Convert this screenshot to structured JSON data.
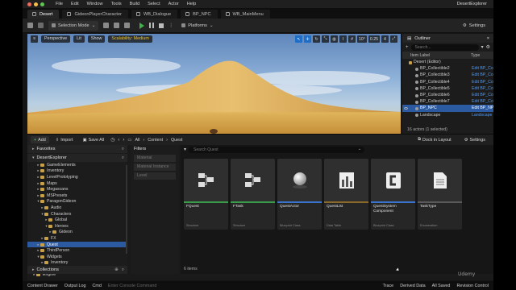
{
  "menubar": {
    "menus": [
      "File",
      "Edit",
      "Window",
      "Tools",
      "Build",
      "Select",
      "Actor",
      "Help"
    ],
    "app_title": "DesertExplorer",
    "traffic_colors": [
      "#ec6a5e",
      "#f4bf4f",
      "#61c554"
    ]
  },
  "tabs": [
    {
      "label": "Desert",
      "active": true
    },
    {
      "label": "GideonPlayerCharacter",
      "active": false
    },
    {
      "label": "WB_Dialogue",
      "active": false
    },
    {
      "label": "BP_NPC",
      "active": false
    },
    {
      "label": "WB_MainMenu",
      "active": false
    }
  ],
  "toolbar": {
    "selection_mode": "Selection Mode",
    "platforms": "Platforms",
    "settings": "Settings"
  },
  "viewport": {
    "perspective": "Perspective",
    "lit": "Lit",
    "show": "Show",
    "scalability": "Scalability: Medium",
    "snap_angle": "10°",
    "snap_scale": "0.25",
    "camera_speed": "4"
  },
  "outliner": {
    "title": "Outliner",
    "search_placeholder": "Search...",
    "col_label": "Item Label",
    "col_type": "Type",
    "rows": [
      {
        "name": "Desert (Editor)",
        "type": "",
        "kind": "root",
        "selected": false
      },
      {
        "name": "BP_Collectible2",
        "type": "Edit BP_Colle",
        "kind": "actor",
        "selected": false
      },
      {
        "name": "BP_Collectible3",
        "type": "Edit BP_Colle",
        "kind": "actor",
        "selected": false
      },
      {
        "name": "BP_Collectible4",
        "type": "Edit BP_Colle",
        "kind": "actor",
        "selected": false
      },
      {
        "name": "BP_Collectible5",
        "type": "Edit BP_Colle",
        "kind": "actor",
        "selected": false
      },
      {
        "name": "BP_Collectible6",
        "type": "Edit BP_Colle",
        "kind": "actor",
        "selected": false
      },
      {
        "name": "BP_Collectible7",
        "type": "Edit BP_Colle",
        "kind": "actor",
        "selected": false
      },
      {
        "name": "BP_NPC",
        "type": "Edit BP_NPC",
        "kind": "actor",
        "selected": true
      },
      {
        "name": "Landscape",
        "type": "Landscape",
        "kind": "actor",
        "selected": false
      }
    ],
    "footer": "16 actors (1 selected)"
  },
  "content_browser": {
    "add_label": "Add",
    "import_label": "Import",
    "save_all_label": "Save All",
    "breadcrumb": [
      "All",
      "Content",
      "Quest"
    ],
    "dock_label": "Dock in Layout",
    "settings_label": "Settings",
    "favorites_label": "Favorites",
    "project_label": "DesertExplorer",
    "collections_label": "Collections",
    "filters_title": "Filters",
    "filter_items": [
      "Material",
      "Material Instance",
      "Level"
    ],
    "search_placeholder": "Search Quest",
    "items_count": "6 items",
    "tree": [
      {
        "label": "GameElements",
        "depth": 1,
        "expanded": false,
        "selected": false
      },
      {
        "label": "Inventory",
        "depth": 1,
        "expanded": false,
        "selected": false
      },
      {
        "label": "LevelPrototyping",
        "depth": 1,
        "expanded": false,
        "selected": false
      },
      {
        "label": "Maps",
        "depth": 1,
        "expanded": false,
        "selected": false
      },
      {
        "label": "Megascans",
        "depth": 1,
        "expanded": false,
        "selected": false
      },
      {
        "label": "MSPresets",
        "depth": 1,
        "expanded": false,
        "selected": false
      },
      {
        "label": "ParagonGideon",
        "depth": 1,
        "expanded": true,
        "selected": false
      },
      {
        "label": "Audio",
        "depth": 2,
        "expanded": false,
        "selected": false
      },
      {
        "label": "Characters",
        "depth": 2,
        "expanded": true,
        "selected": false
      },
      {
        "label": "Global",
        "depth": 3,
        "expanded": false,
        "selected": false
      },
      {
        "label": "Heroes",
        "depth": 3,
        "expanded": true,
        "selected": false
      },
      {
        "label": "Gideon",
        "depth": 4,
        "expanded": false,
        "selected": false
      },
      {
        "label": "FX",
        "depth": 2,
        "expanded": false,
        "selected": false
      },
      {
        "label": "Quest",
        "depth": 1,
        "expanded": false,
        "selected": true
      },
      {
        "label": "ThirdPerson",
        "depth": 1,
        "expanded": false,
        "selected": false
      },
      {
        "label": "Widgets",
        "depth": 1,
        "expanded": true,
        "selected": false
      },
      {
        "label": "Inventory",
        "depth": 2,
        "expanded": false,
        "selected": false
      },
      {
        "label": "Quest",
        "depth": 2,
        "expanded": false,
        "selected": false
      },
      {
        "label": "Engine",
        "depth": 0,
        "expanded": false,
        "selected": false
      }
    ],
    "assets": [
      {
        "name": "FQuest",
        "type": "Structure",
        "icon": "struct-icon",
        "color": "#3a9b4a"
      },
      {
        "name": "FTask",
        "type": "Structure",
        "icon": "struct-icon",
        "color": "#3a9b4a"
      },
      {
        "name": "QuestActor",
        "type": "Blueprint Class",
        "icon": "sphere-icon",
        "color": "#3a73c9"
      },
      {
        "name": "QuestList",
        "type": "Data Table",
        "icon": "datatable-icon",
        "color": "#8a6a2a"
      },
      {
        "name": "QuestSystem Component",
        "type": "Blueprint Class",
        "icon": "component-icon",
        "color": "#3a73c9"
      },
      {
        "name": "TaskType",
        "type": "Enumeration",
        "icon": "enum-icon",
        "color": "#5a5a5a"
      }
    ]
  },
  "statusbar": {
    "content_drawer": "Content Drawer",
    "output_log": "Output Log",
    "cmd": "Cmd",
    "cmd_placeholder": "Enter Console Command",
    "trace": "Trace",
    "derived_data": "Derived Data",
    "all_saved": "All Saved",
    "revision_control": "Revision Control"
  },
  "watermark": "Udemy"
}
